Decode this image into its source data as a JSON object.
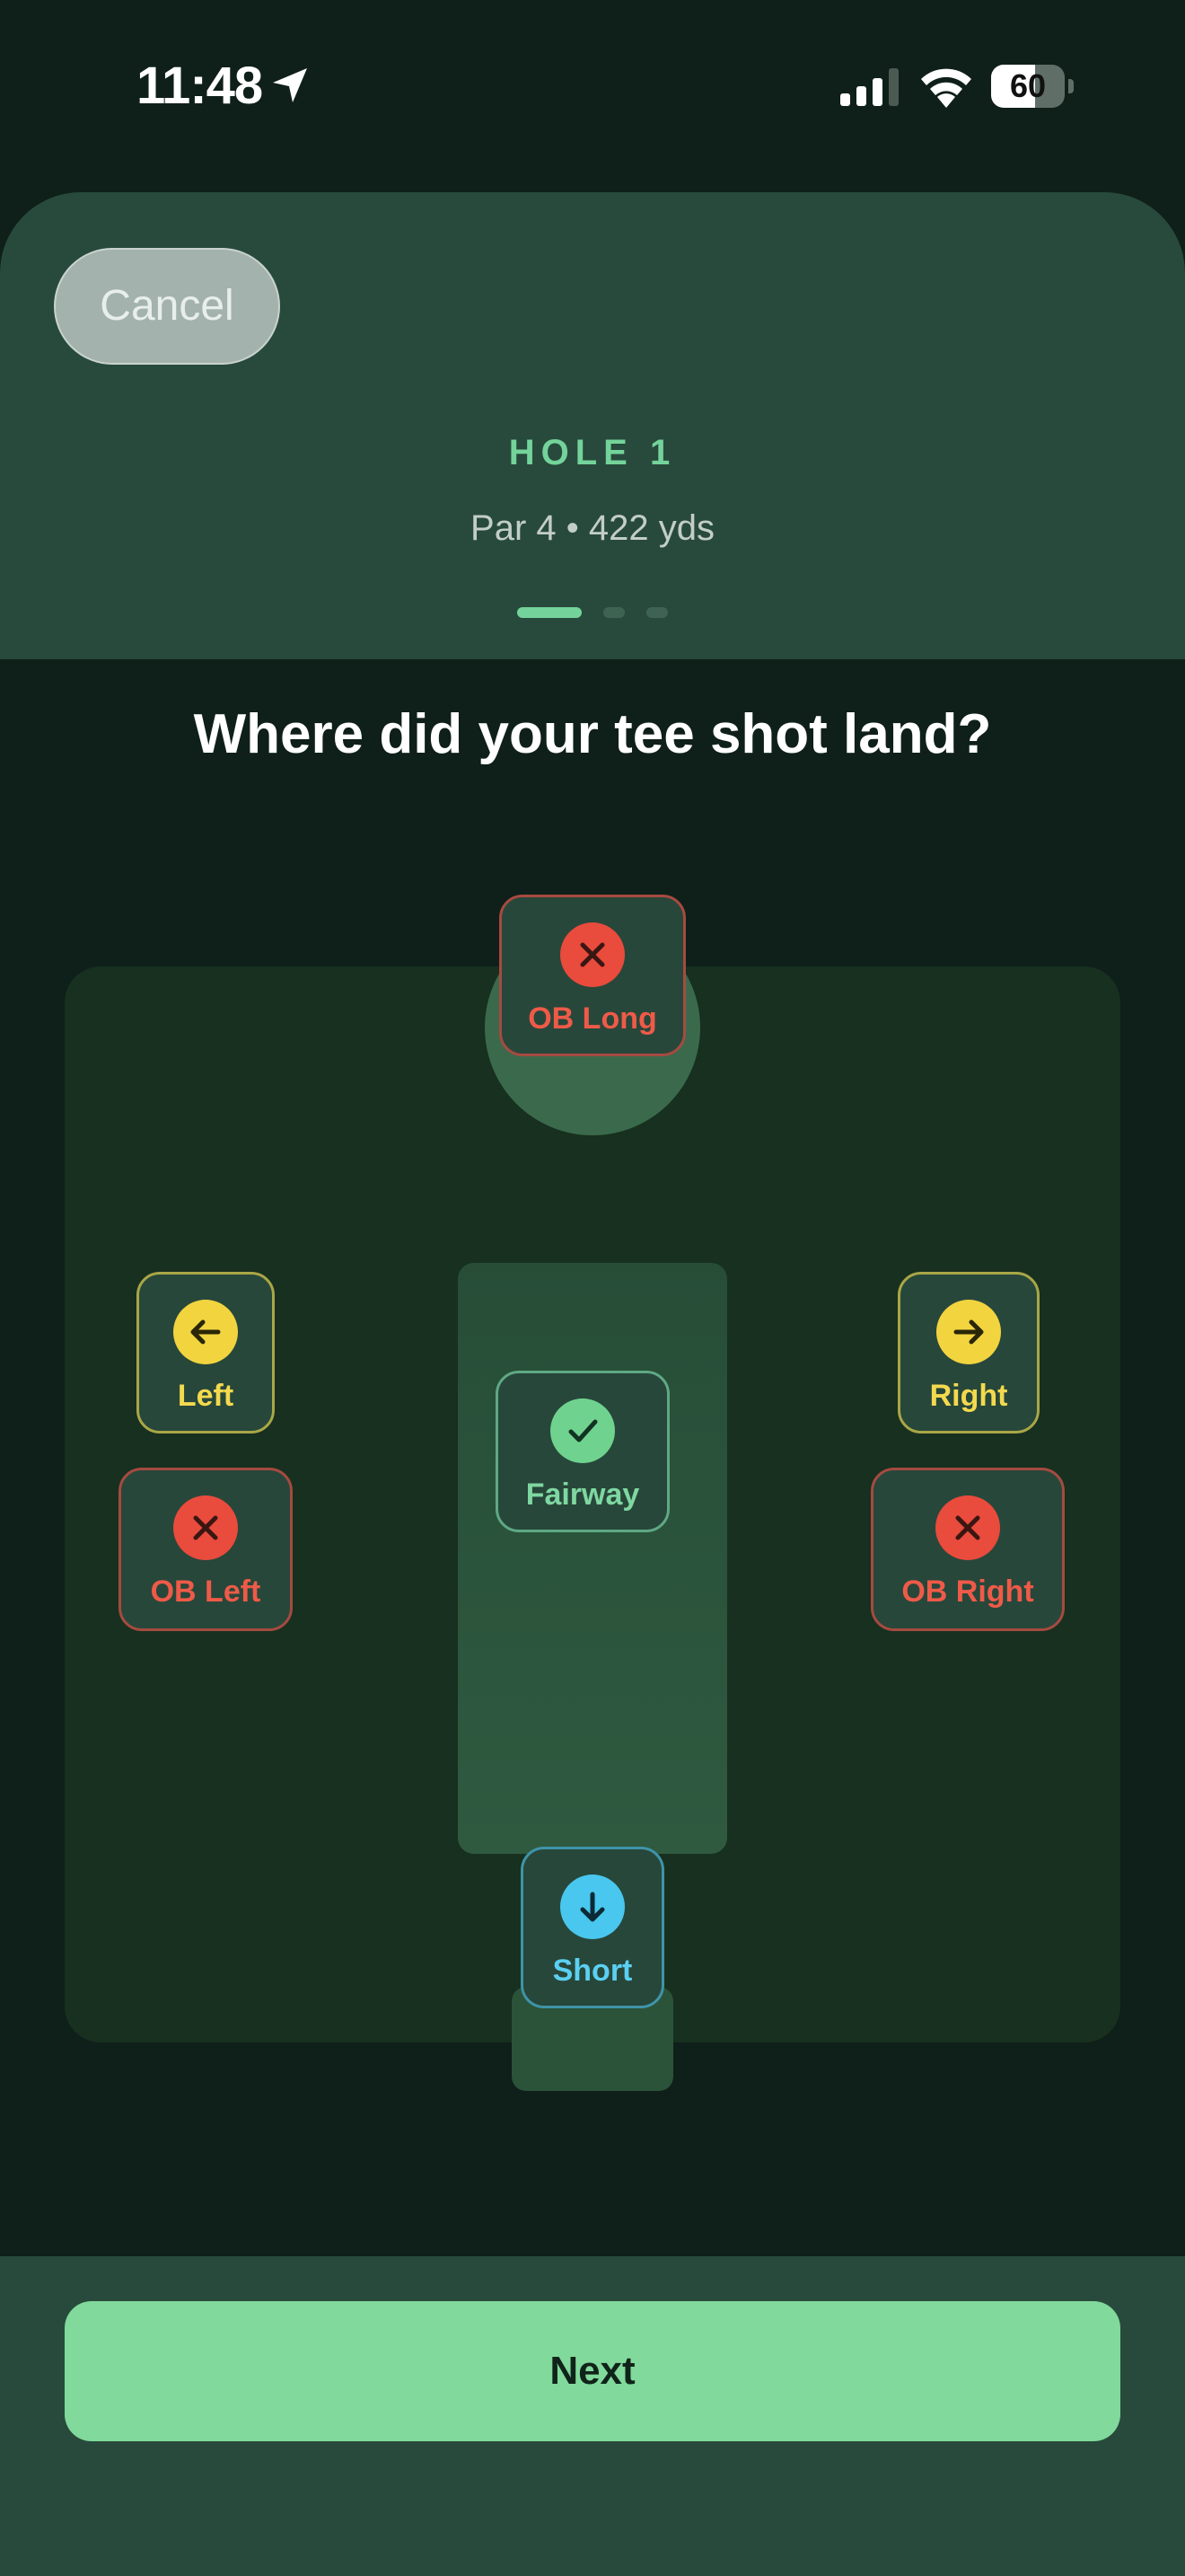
{
  "status_bar": {
    "time": "11:48",
    "battery_percent": 60
  },
  "header": {
    "cancel_label": "Cancel",
    "hole_label": "HOLE 1",
    "hole_meta": "Par 4 • 422 yds",
    "page_indicator": {
      "total": 3,
      "current": 1
    }
  },
  "question": "Where did your tee shot land?",
  "options": {
    "ob_long": {
      "label": "OB Long",
      "icon": "x-icon"
    },
    "left": {
      "label": "Left",
      "icon": "arrow-left-icon"
    },
    "right": {
      "label": "Right",
      "icon": "arrow-right-icon"
    },
    "fairway": {
      "label": "Fairway",
      "icon": "check-icon"
    },
    "ob_left": {
      "label": "OB Left",
      "icon": "x-icon"
    },
    "ob_right": {
      "label": "OB Right",
      "icon": "x-icon"
    },
    "short": {
      "label": "Short",
      "icon": "arrow-down-icon"
    }
  },
  "footer": {
    "next_label": "Next"
  },
  "colors": {
    "accent_green": "#81d99b",
    "ob_red": "#e94b3c",
    "miss_yellow": "#f2d43f",
    "short_blue": "#49c7ee",
    "background": "#0f1f1a",
    "panel": "#274a3c"
  }
}
